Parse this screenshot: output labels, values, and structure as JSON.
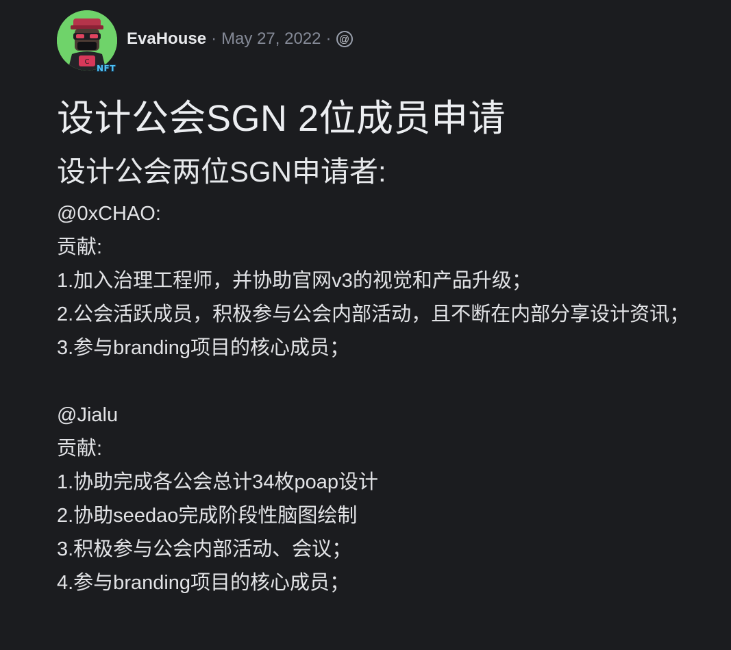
{
  "post": {
    "author": "EvaHouse",
    "date": "May 27, 2022",
    "separator": "·",
    "avatar_badge": "NFT",
    "visibility_icon": "at-icon",
    "title": "设计公会SGN 2位成员申请",
    "subtitle": "设计公会两位SGN申请者:",
    "body": {
      "applicant1": {
        "handle": "@0xCHAO:",
        "contrib_label": "贡献:",
        "items": [
          "1.加入治理工程师，并协助官网v3的视觉和产品升级；",
          "2.公会活跃成员，积极参与公会内部活动，且不断在内部分享设计资讯；",
          "3.参与branding项目的核心成员；"
        ]
      },
      "applicant2": {
        "handle": "@Jialu",
        "contrib_label": "贡献:",
        "items": [
          "1.协助完成各公会总计34枚poap设计",
          "2.协助seedao完成阶段性脑图绘制",
          "3.积极参与公会内部活动、会议；",
          "4.参与branding项目的核心成员；"
        ]
      }
    }
  },
  "colors": {
    "background": "#1b1c1f",
    "text": "#e2e3e6",
    "muted": "#858a97",
    "avatar_bg": "#6fd36a",
    "badge": "#4fc2f7"
  }
}
